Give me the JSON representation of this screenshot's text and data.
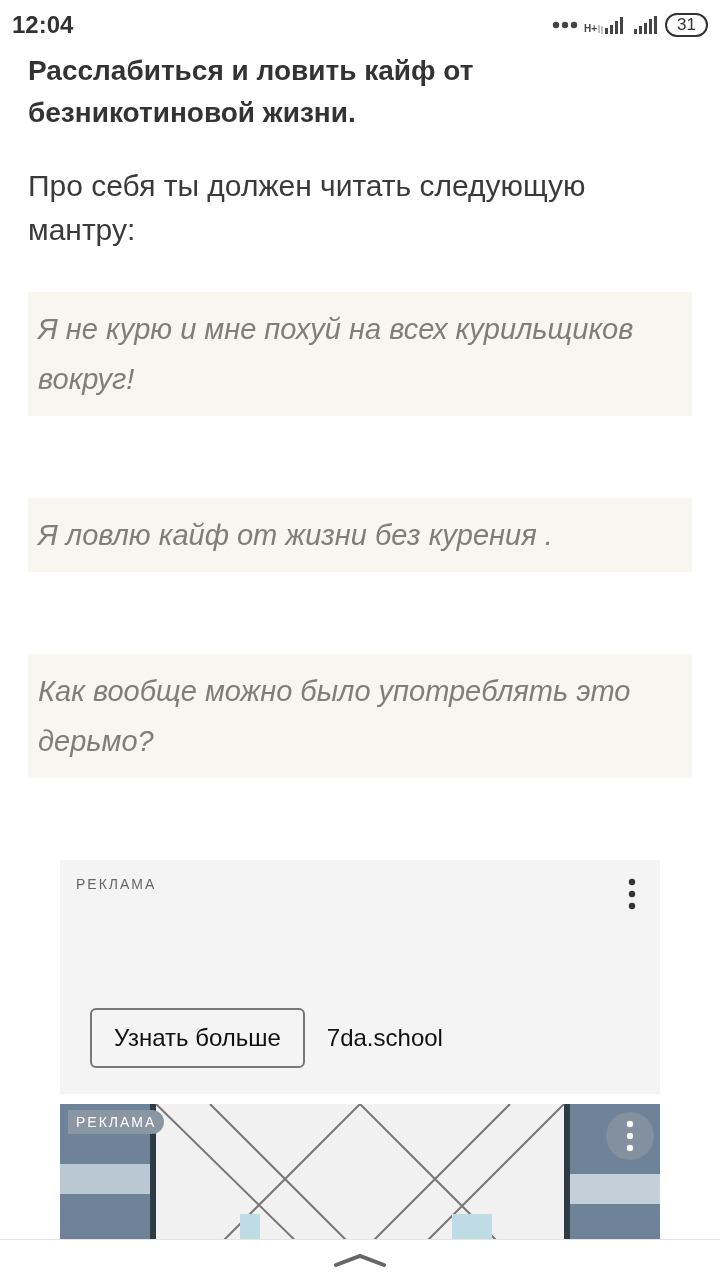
{
  "status_bar": {
    "time": "12:04",
    "network": "H+",
    "battery": "31"
  },
  "article": {
    "heading": "Расслабиться и ловить кайф от безникотиновой жизни.",
    "paragraph": "Про себя ты должен читать следующую мантру:",
    "quotes": [
      "Я не курю и мне похуй на всех курильщиков вокруг!",
      "Я ловлю кайф от жизни без курения .",
      "Как вообще можно было употреблять это дерьмо?"
    ]
  },
  "ads": [
    {
      "kind": "text",
      "label": "РЕКЛАМА",
      "button": "Узнать больше",
      "domain": "7da.school"
    },
    {
      "kind": "picture",
      "label": "РЕКЛАМА"
    }
  ]
}
